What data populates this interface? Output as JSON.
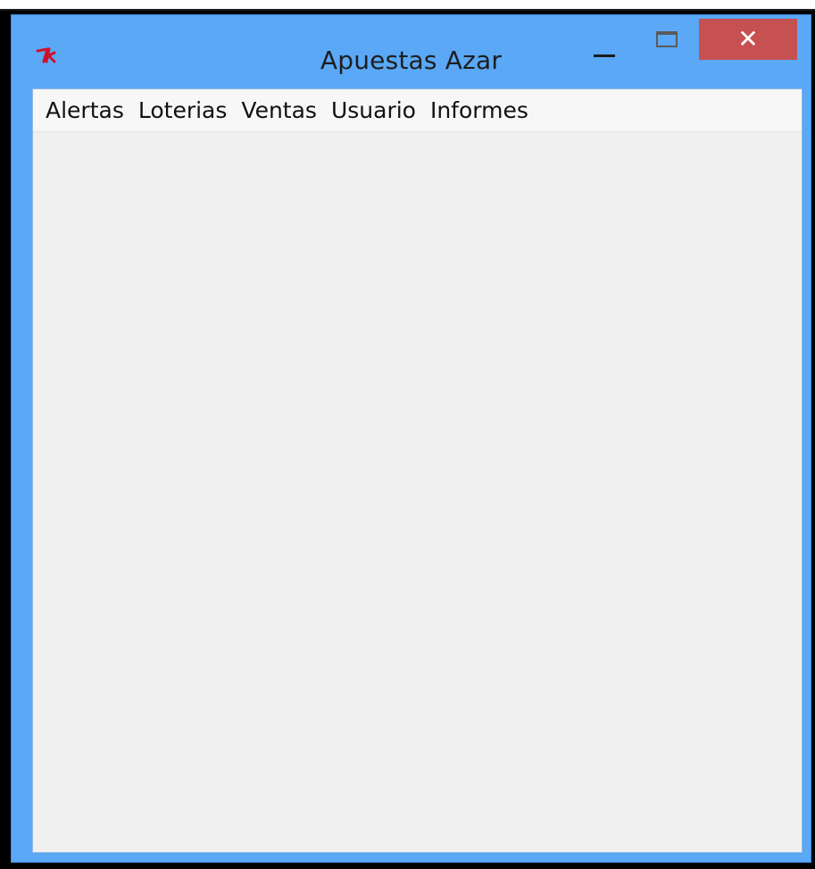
{
  "window": {
    "title": "Apuestas Azar",
    "icon": "tk-feather-icon",
    "controls": {
      "minimize": "minimize",
      "maximize": "maximize",
      "close": "✕"
    },
    "colors": {
      "frame": "#5aa8f6",
      "close_button": "#c75050",
      "client": "#f0f0f0"
    }
  },
  "menubar": {
    "items": [
      {
        "label": "Alertas"
      },
      {
        "label": "Loterias"
      },
      {
        "label": "Ventas"
      },
      {
        "label": "Usuario"
      },
      {
        "label": "Informes"
      }
    ]
  }
}
